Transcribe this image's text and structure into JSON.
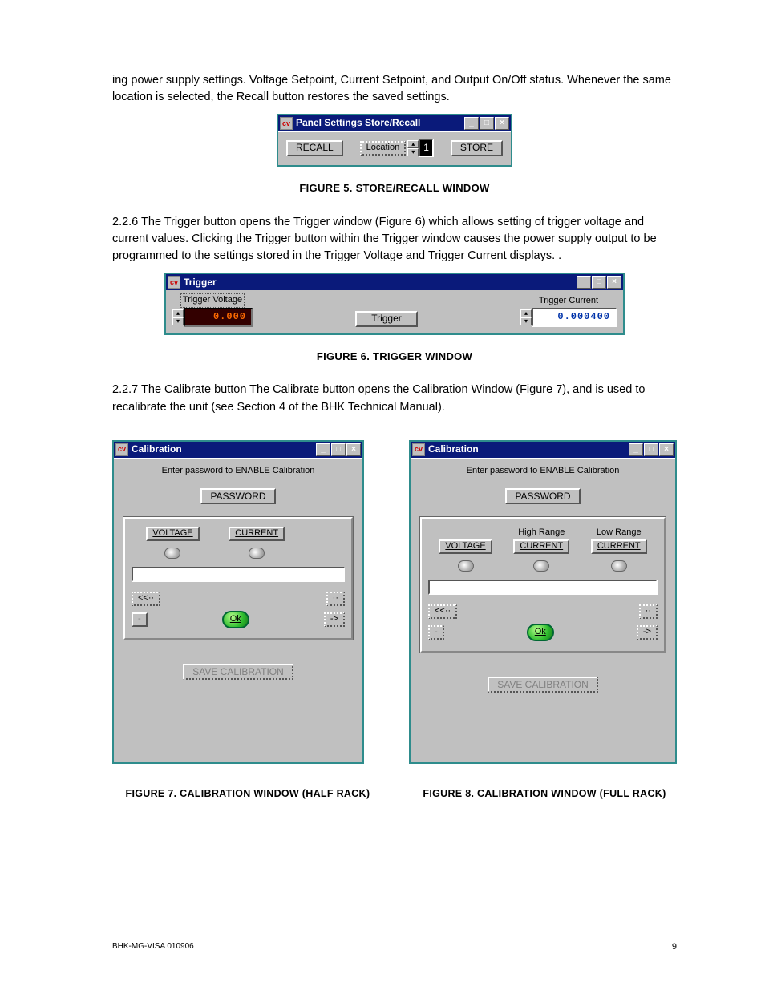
{
  "body": {
    "intro": "ing power supply settings. Voltage Setpoint, Current Setpoint, and Output On/Off status. Whenever the same location is selected, the Recall button restores the saved settings.",
    "sec226": "2.2.6    The Trigger button opens the Trigger window (Figure 6) which allows setting of trigger voltage and current values. Clicking the Trigger button within the Trigger window causes the power supply output to be programmed to the settings stored in the Trigger Voltage and Trigger Current displays. .",
    "sec227": "2.2.7    The Calibrate button The Calibrate button opens the Calibration Window (Figure 7), and is used to recalibrate the unit (see Section 4 of the BHK Technical Manual)."
  },
  "captions": {
    "fig5": "FIGURE 5.    STORE/RECALL WINDOW",
    "fig6": "FIGURE 6.    TRIGGER WINDOW",
    "fig7": "FIGURE 7.    CALIBRATION WINDOW (HALF RACK)",
    "fig8": "FIGURE 8.    CALIBRATION WINDOW (FULL RACK)"
  },
  "fig5": {
    "title": "Panel Settings Store/Recall",
    "recall": "RECALL",
    "location_label": "Location",
    "location_value": "1",
    "store": "STORE"
  },
  "fig6": {
    "title": "Trigger",
    "voltage_label": "Trigger Voltage",
    "voltage_value": "0.000",
    "button": "Trigger",
    "current_label": "Trigger Current",
    "current_value": "0.000400"
  },
  "calib_common": {
    "title": "Calibration",
    "prompt": "Enter password to ENABLE Calibration",
    "password": "PASSWORD",
    "voltage": "VOLTAGE",
    "current": "CURRENT",
    "high_range": "High Range",
    "low_range": "Low Range",
    "back": "<<··",
    "fwd": "··",
    "minus": "-",
    "next": "->",
    "ok": "Ok",
    "save": "SAVE CALIBRATION"
  },
  "footer": {
    "left": "BHK-MG-VISA 010906",
    "right": "9"
  }
}
